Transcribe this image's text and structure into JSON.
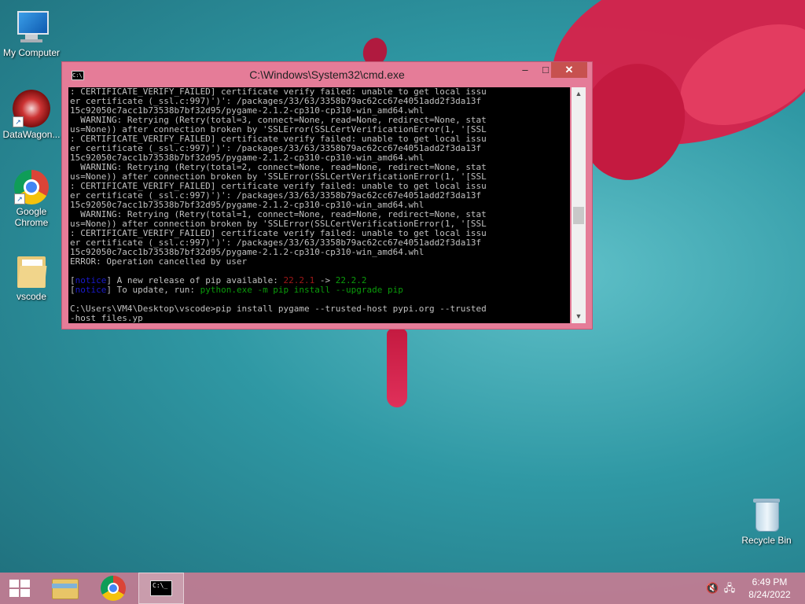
{
  "desktop": {
    "icons": [
      {
        "label": "My Computer"
      },
      {
        "label": "DataWagon..."
      },
      {
        "label": "Google\nChrome"
      },
      {
        "label": "vscode"
      },
      {
        "label": "Recycle Bin"
      }
    ]
  },
  "window": {
    "title": "C:\\Windows\\System32\\cmd.exe",
    "buttons": {
      "minimize": "–",
      "maximize": "□",
      "close": "✕"
    },
    "console_lines": [
      ": CERTIFICATE_VERIFY_FAILED] certificate verify failed: unable to get local issu",
      "er certificate (_ssl.c:997)')': /packages/33/63/3358b79ac62cc67e4051add2f3da13f",
      "15c92050c7acc1b73538b7bf32d95/pygame-2.1.2-cp310-cp310-win_amd64.whl",
      "  WARNING: Retrying (Retry(total=3, connect=None, read=None, redirect=None, stat",
      "us=None)) after connection broken by 'SSLError(SSLCertVerificationError(1, '[SSL",
      ": CERTIFICATE_VERIFY_FAILED] certificate verify failed: unable to get local issu",
      "er certificate (_ssl.c:997)')': /packages/33/63/3358b79ac62cc67e4051add2f3da13f",
      "15c92050c7acc1b73538b7bf32d95/pygame-2.1.2-cp310-cp310-win_amd64.whl",
      "  WARNING: Retrying (Retry(total=2, connect=None, read=None, redirect=None, stat",
      "us=None)) after connection broken by 'SSLError(SSLCertVerificationError(1, '[SSL",
      ": CERTIFICATE_VERIFY_FAILED] certificate verify failed: unable to get local issu",
      "er certificate (_ssl.c:997)')': /packages/33/63/3358b79ac62cc67e4051add2f3da13f",
      "15c92050c7acc1b73538b7bf32d95/pygame-2.1.2-cp310-cp310-win_amd64.whl",
      "  WARNING: Retrying (Retry(total=1, connect=None, read=None, redirect=None, stat",
      "us=None)) after connection broken by 'SSLError(SSLCertVerificationError(1, '[SSL",
      ": CERTIFICATE_VERIFY_FAILED] certificate verify failed: unable to get local issu",
      "er certificate (_ssl.c:997)')': /packages/33/63/3358b79ac62cc67e4051add2f3da13f",
      "15c92050c7acc1b73538b7bf32d95/pygame-2.1.2-cp310-cp310-win_amd64.whl"
    ],
    "error_line": "ERROR: Operation cancelled by user",
    "notice_tag": "notice",
    "pip_notice_1": {
      "text": " A new release of pip available: ",
      "old_version": "22.2.1",
      "arrow": " -> ",
      "new_version": "22.2.2"
    },
    "pip_notice_2": {
      "text": " To update, run: ",
      "command": "python.exe -m pip install --upgrade pip"
    },
    "prompt_line_1": "C:\\Users\\VM4\\Desktop\\vscode>pip install pygame --trusted-host pypi.org --trusted",
    "prompt_line_2": "-host files.yp"
  },
  "taskbar": {
    "cmd_icon_text": "C:\\_",
    "clock": {
      "time": "6:49 PM",
      "date": "8/24/2022"
    }
  },
  "colors": {
    "window_frame": "#e57c98",
    "close_button": "#c7514f",
    "console_bg": "#000000",
    "console_warning": "#c9c96b",
    "console_error": "#a01818"
  }
}
